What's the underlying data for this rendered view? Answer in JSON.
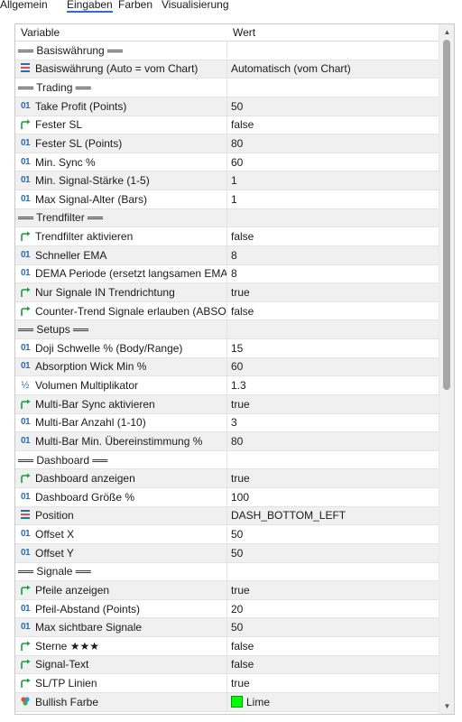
{
  "tabs": [
    {
      "label": "Allgemein",
      "active": false
    },
    {
      "label": "Eingaben",
      "active": true
    },
    {
      "label": "Farben",
      "active": false
    },
    {
      "label": "Visualisierung",
      "active": false
    }
  ],
  "table": {
    "col_variable": "Variable",
    "col_value": "Wert",
    "rows": [
      {
        "kind": "section",
        "label": "══ Basiswährung ══",
        "value": ""
      },
      {
        "kind": "enum",
        "label": "Basiswährung (Auto = vom Chart)",
        "value": "Automatisch (vom Chart)"
      },
      {
        "kind": "section",
        "label": "══ Trading ══",
        "value": ""
      },
      {
        "kind": "int",
        "label": "Take Profit (Points)",
        "value": "50"
      },
      {
        "kind": "bool",
        "label": "Fester SL",
        "value": "false"
      },
      {
        "kind": "int",
        "label": "Fester SL (Points)",
        "value": "80"
      },
      {
        "kind": "int",
        "label": "Min. Sync %",
        "value": "60"
      },
      {
        "kind": "int",
        "label": "Min. Signal-Stärke (1-5)",
        "value": "1"
      },
      {
        "kind": "int",
        "label": "Max Signal-Alter (Bars)",
        "value": "1"
      },
      {
        "kind": "section",
        "label": "══ Trendfilter ══",
        "value": ""
      },
      {
        "kind": "bool",
        "label": "Trendfilter aktivieren",
        "value": "false"
      },
      {
        "kind": "int",
        "label": "Schneller EMA",
        "value": "8"
      },
      {
        "kind": "int",
        "label": "DEMA Periode (ersetzt langsamen EMA)",
        "value": "8"
      },
      {
        "kind": "bool",
        "label": "Nur Signale IN Trendrichtung",
        "value": "true"
      },
      {
        "kind": "bool",
        "label": "Counter-Trend Signale erlauben (ABSO...",
        "value": "false"
      },
      {
        "kind": "section",
        "label": "══ Setups ══",
        "value": ""
      },
      {
        "kind": "int",
        "label": "Doji Schwelle % (Body/Range)",
        "value": "15"
      },
      {
        "kind": "int",
        "label": "Absorption Wick Min %",
        "value": "60"
      },
      {
        "kind": "double",
        "label": "Volumen Multiplikator",
        "value": "1.3"
      },
      {
        "kind": "bool",
        "label": "Multi-Bar Sync aktivieren",
        "value": "true"
      },
      {
        "kind": "int",
        "label": "Multi-Bar Anzahl (1-10)",
        "value": "3"
      },
      {
        "kind": "int",
        "label": "Multi-Bar Min. Übereinstimmung %",
        "value": "80"
      },
      {
        "kind": "section",
        "label": "══ Dashboard ══",
        "value": ""
      },
      {
        "kind": "bool",
        "label": "Dashboard anzeigen",
        "value": "true"
      },
      {
        "kind": "int",
        "label": "Dashboard Größe %",
        "value": "100"
      },
      {
        "kind": "enum",
        "label": "Position",
        "value": "DASH_BOTTOM_LEFT"
      },
      {
        "kind": "int",
        "label": "Offset X",
        "value": "50"
      },
      {
        "kind": "int",
        "label": "Offset Y",
        "value": "50"
      },
      {
        "kind": "section",
        "label": "══ Signale ══",
        "value": ""
      },
      {
        "kind": "bool",
        "label": "Pfeile anzeigen",
        "value": "true"
      },
      {
        "kind": "int",
        "label": "Pfeil-Abstand (Points)",
        "value": "20"
      },
      {
        "kind": "int",
        "label": "Max sichtbare Signale",
        "value": "50"
      },
      {
        "kind": "bool",
        "label": "Sterne ★★★",
        "value": "false"
      },
      {
        "kind": "bool",
        "label": "Signal-Text",
        "value": "false"
      },
      {
        "kind": "bool",
        "label": "SL/TP Linien",
        "value": "true"
      },
      {
        "kind": "color",
        "label": "Bullish Farbe",
        "value": "Lime",
        "swatch": "#00ff00"
      }
    ]
  },
  "icons": {
    "int": "integer-icon",
    "double": "fraction-icon",
    "bool": "boolean-arrow-icon",
    "enum": "enum-list-icon",
    "color": "color-palette-icon"
  },
  "colors": {
    "tab_underline": "#2f6bd1",
    "int_icon": "#2b6cb0",
    "bool_icon": "#1e9b3c",
    "swatch_lime": "#00ff00"
  }
}
